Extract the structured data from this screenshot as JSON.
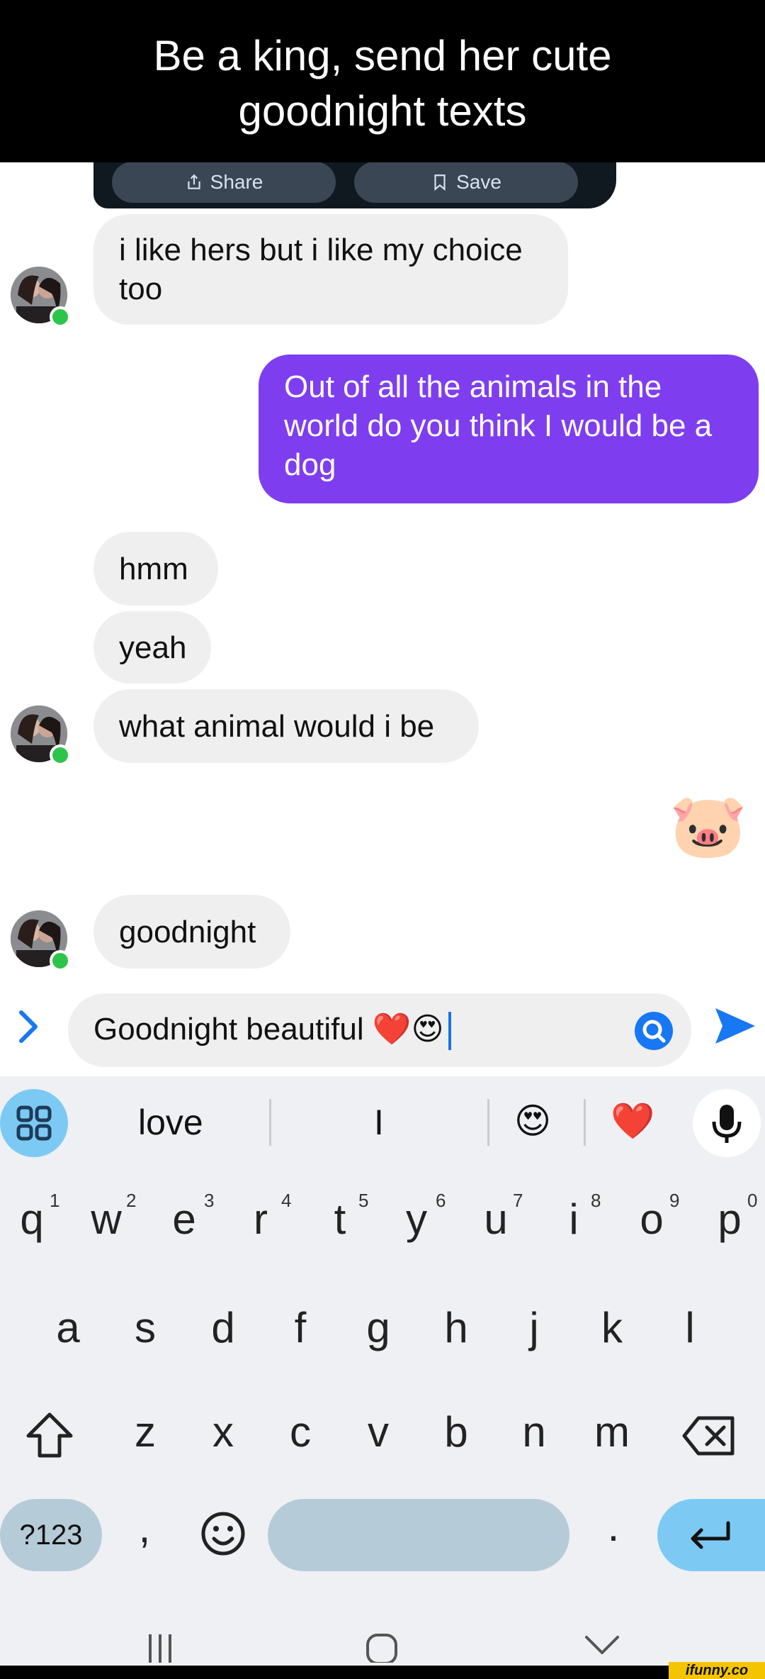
{
  "caption": {
    "line1": "Be a king, send her cute",
    "line2": "goodnight texts"
  },
  "card": {
    "share_label": "Share",
    "save_label": "Save"
  },
  "messages": [
    {
      "line1": "i like hers but i like my choice",
      "line2": "too"
    },
    {
      "text": "Out of all the animals in the world do you think I would be a dog"
    },
    {
      "text": "hmm"
    },
    {
      "text": "yeah"
    },
    {
      "text": "what animal would i be"
    },
    {
      "emoji": "🐷"
    },
    {
      "text": "goodnight"
    }
  ],
  "composer": {
    "text": "Goodnight beautiful ❤️😍"
  },
  "keyboard": {
    "suggestions": [
      "love",
      "I",
      "😍",
      "❤️"
    ],
    "row1": [
      "q",
      "w",
      "e",
      "r",
      "t",
      "y",
      "u",
      "i",
      "o",
      "p"
    ],
    "row1_numbers": [
      "1",
      "2",
      "3",
      "4",
      "5",
      "6",
      "7",
      "8",
      "9",
      "0"
    ],
    "row2": [
      "a",
      "s",
      "d",
      "f",
      "g",
      "h",
      "j",
      "k",
      "l"
    ],
    "row3": [
      "z",
      "x",
      "c",
      "v",
      "b",
      "n",
      "m"
    ],
    "symbols_label": "?123",
    "comma": ",",
    "period": "."
  },
  "watermark": "ifunny.co",
  "colors": {
    "outgoing_bubble": "#7e3ef0",
    "incoming_bubble": "#efeff0",
    "send_blue": "#1877f2"
  }
}
